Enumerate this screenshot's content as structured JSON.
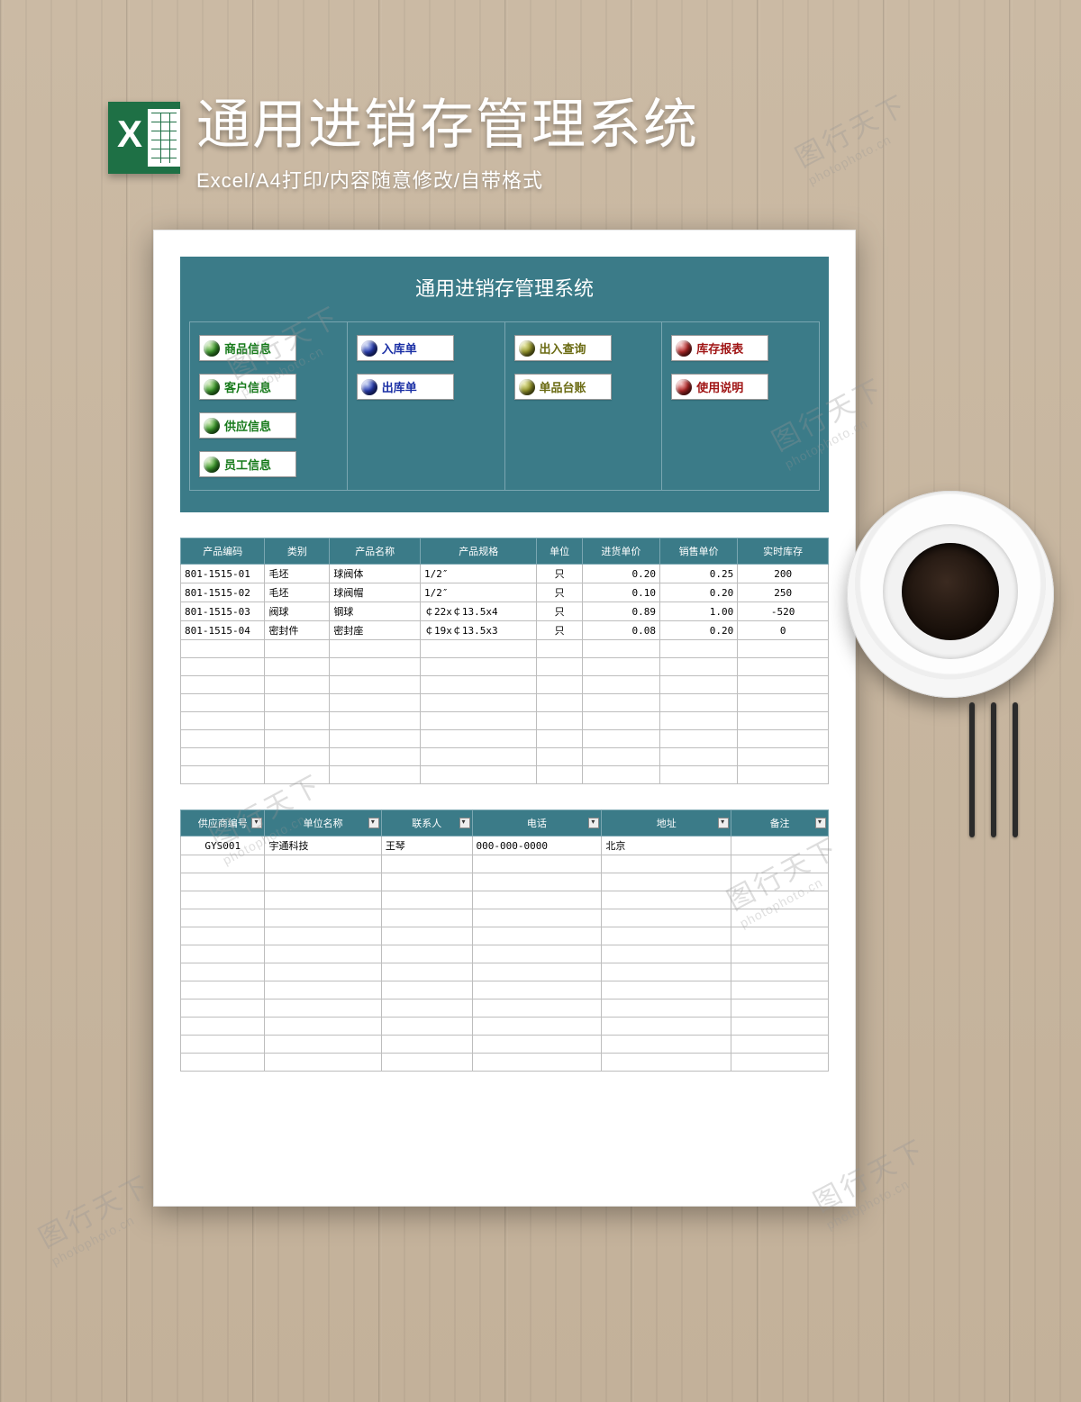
{
  "header": {
    "main_title": "通用进销存管理系统",
    "sub_title": "Excel/A4打印/内容随意修改/自带格式"
  },
  "panel": {
    "title": "通用进销存管理系统",
    "cols": [
      {
        "buttons": [
          {
            "label": "商品信息",
            "color": "green"
          },
          {
            "label": "客户信息",
            "color": "green"
          },
          {
            "label": "供应信息",
            "color": "green"
          },
          {
            "label": "员工信息",
            "color": "green"
          }
        ]
      },
      {
        "buttons": [
          {
            "label": "入库单",
            "color": "blue"
          },
          {
            "label": "出库单",
            "color": "blue"
          }
        ]
      },
      {
        "buttons": [
          {
            "label": "出入查询",
            "color": "olive"
          },
          {
            "label": "单品台账",
            "color": "olive"
          }
        ]
      },
      {
        "buttons": [
          {
            "label": "库存报表",
            "color": "red"
          },
          {
            "label": "使用说明",
            "color": "red"
          }
        ]
      }
    ]
  },
  "table1": {
    "headers": [
      "产品编码",
      "类别",
      "产品名称",
      "产品规格",
      "单位",
      "进货单价",
      "销售单价",
      "实时库存"
    ],
    "rows": [
      [
        "801-1515-01",
        "毛坯",
        "球阀体",
        "1/2″",
        "只",
        "0.20",
        "0.25",
        "200"
      ],
      [
        "801-1515-02",
        "毛坯",
        "球阀帽",
        "1/2″",
        "只",
        "0.10",
        "0.20",
        "250"
      ],
      [
        "801-1515-03",
        "阀球",
        "钢球",
        "￠22x￠13.5x4",
        "只",
        "0.89",
        "1.00",
        "-520"
      ],
      [
        "801-1515-04",
        "密封件",
        "密封座",
        "￠19x￠13.5x3",
        "只",
        "0.08",
        "0.20",
        "0"
      ]
    ],
    "empty_rows": 8
  },
  "table2": {
    "headers": [
      "供应商编号",
      "单位名称",
      "联系人",
      "电话",
      "地址",
      "备注"
    ],
    "rows": [
      [
        "GYS001",
        "宇通科技",
        "王琴",
        "000-000-0000",
        "北京",
        ""
      ]
    ],
    "empty_rows": 12
  },
  "watermark": {
    "brand": "图行天下",
    "url": "photophoto.cn"
  }
}
